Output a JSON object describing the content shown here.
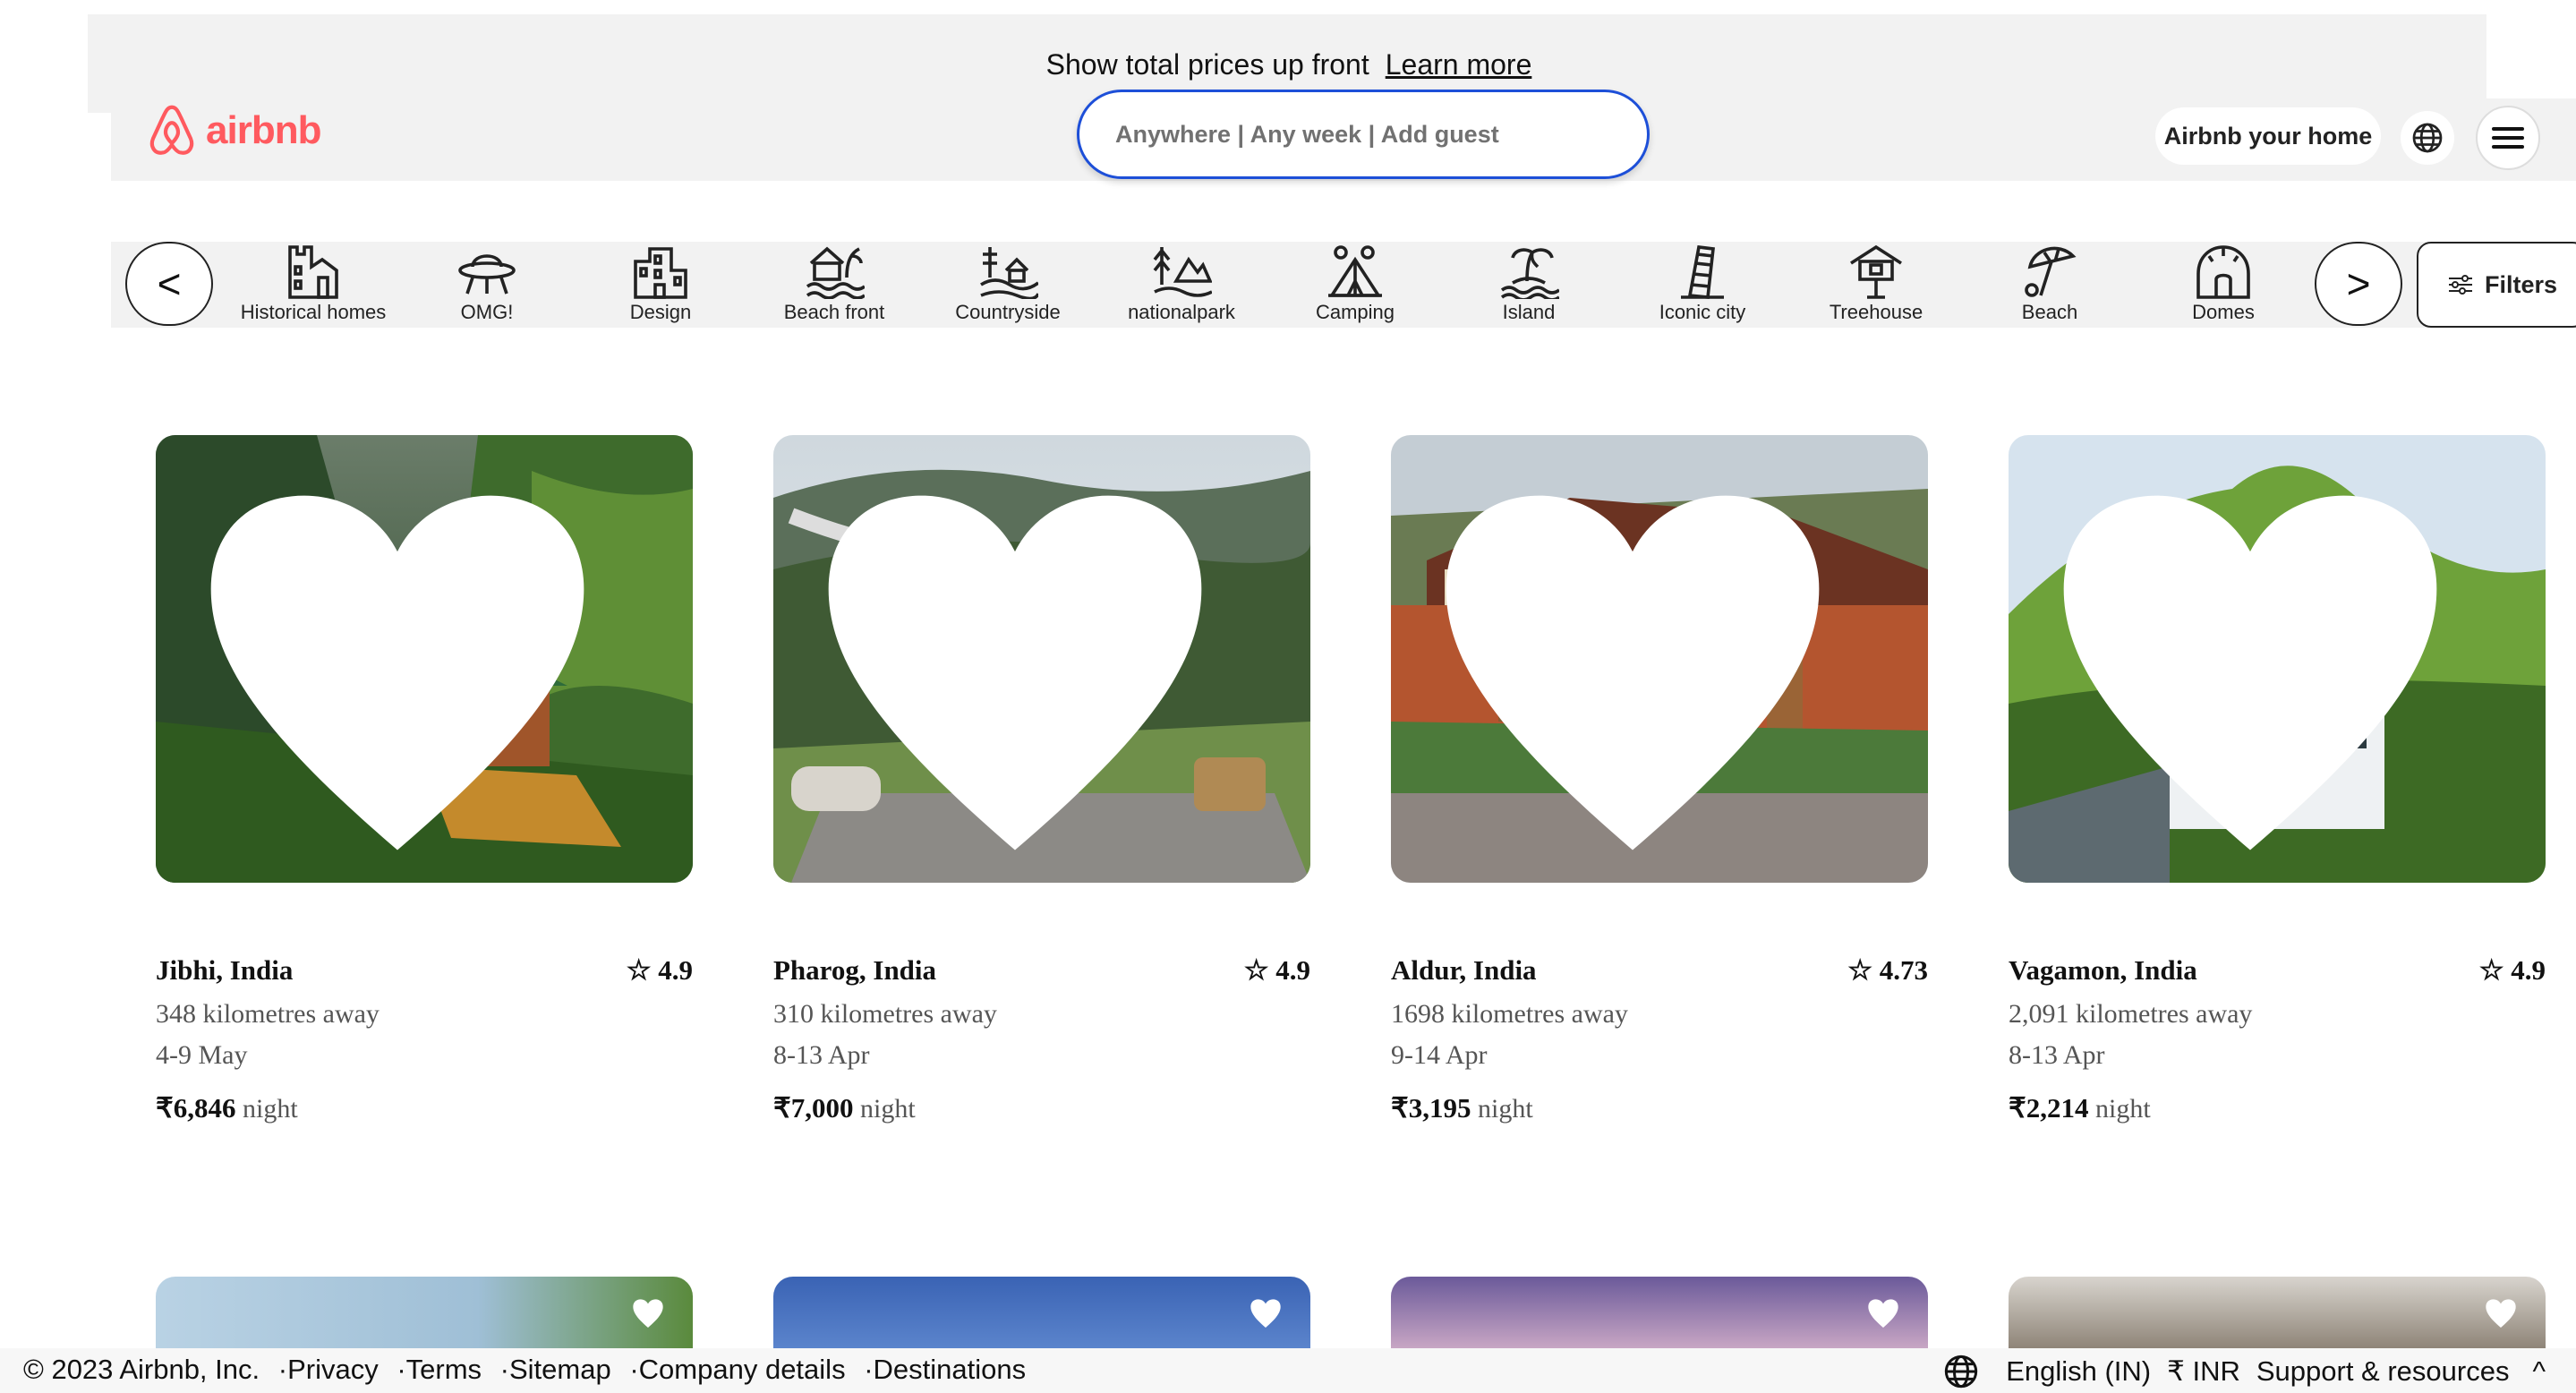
{
  "banner": {
    "text": "Show total prices up front",
    "link": "Learn more"
  },
  "header": {
    "logo_text": "airbnb",
    "search_text": "Anywhere | Any week | Add guest",
    "host_label": "Airbnb your home"
  },
  "categories": [
    {
      "label": "Historical homes",
      "icon": "castle-icon"
    },
    {
      "label": "OMG!",
      "icon": "ufo-icon"
    },
    {
      "label": "Design",
      "icon": "building-icon"
    },
    {
      "label": "Beach front",
      "icon": "beach-house-icon"
    },
    {
      "label": "Countryside",
      "icon": "countryside-icon"
    },
    {
      "label": "nationalpark",
      "icon": "park-icon"
    },
    {
      "label": "Camping",
      "icon": "tent-icon"
    },
    {
      "label": "Island",
      "icon": "island-icon"
    },
    {
      "label": "Iconic city",
      "icon": "leaning-tower-icon"
    },
    {
      "label": "Treehouse",
      "icon": "treehouse-icon"
    },
    {
      "label": "Beach",
      "icon": "umbrella-icon"
    },
    {
      "label": "Domes",
      "icon": "dome-icon"
    }
  ],
  "nav": {
    "prev": "<",
    "next": ">",
    "filters": "Filters"
  },
  "listings": [
    {
      "title": "Jibhi, India",
      "rating": "4.9",
      "distance": "348 kilometres away",
      "dates": "4-9 May",
      "price": "₹6,846",
      "unit": "night"
    },
    {
      "title": "Pharog, India",
      "rating": "4.9",
      "distance": "310 kilometres away",
      "dates": "8-13 Apr",
      "price": "₹7,000",
      "unit": "night"
    },
    {
      "title": "Aldur, India",
      "rating": "4.73",
      "distance": "1698 kilometres away",
      "dates": "9-14 Apr",
      "price": "₹3,195",
      "unit": "night"
    },
    {
      "title": "Vagamon, India",
      "rating": "4.9",
      "distance": "2,091 kilometres away",
      "dates": "8-13 Apr",
      "price": "₹2,214",
      "unit": "night"
    }
  ],
  "footer": {
    "copyright": "© 2023 Airbnb, Inc.",
    "links": [
      "·Privacy",
      "·Terms",
      "·Sitemap",
      "·Company details",
      "·Destinations"
    ],
    "language": "English (IN)",
    "currency": "₹ INR",
    "support": "Support & resources",
    "expand": "^"
  },
  "colors": {
    "brand": "#ff5a5f",
    "search_border": "#1d4fd8"
  }
}
